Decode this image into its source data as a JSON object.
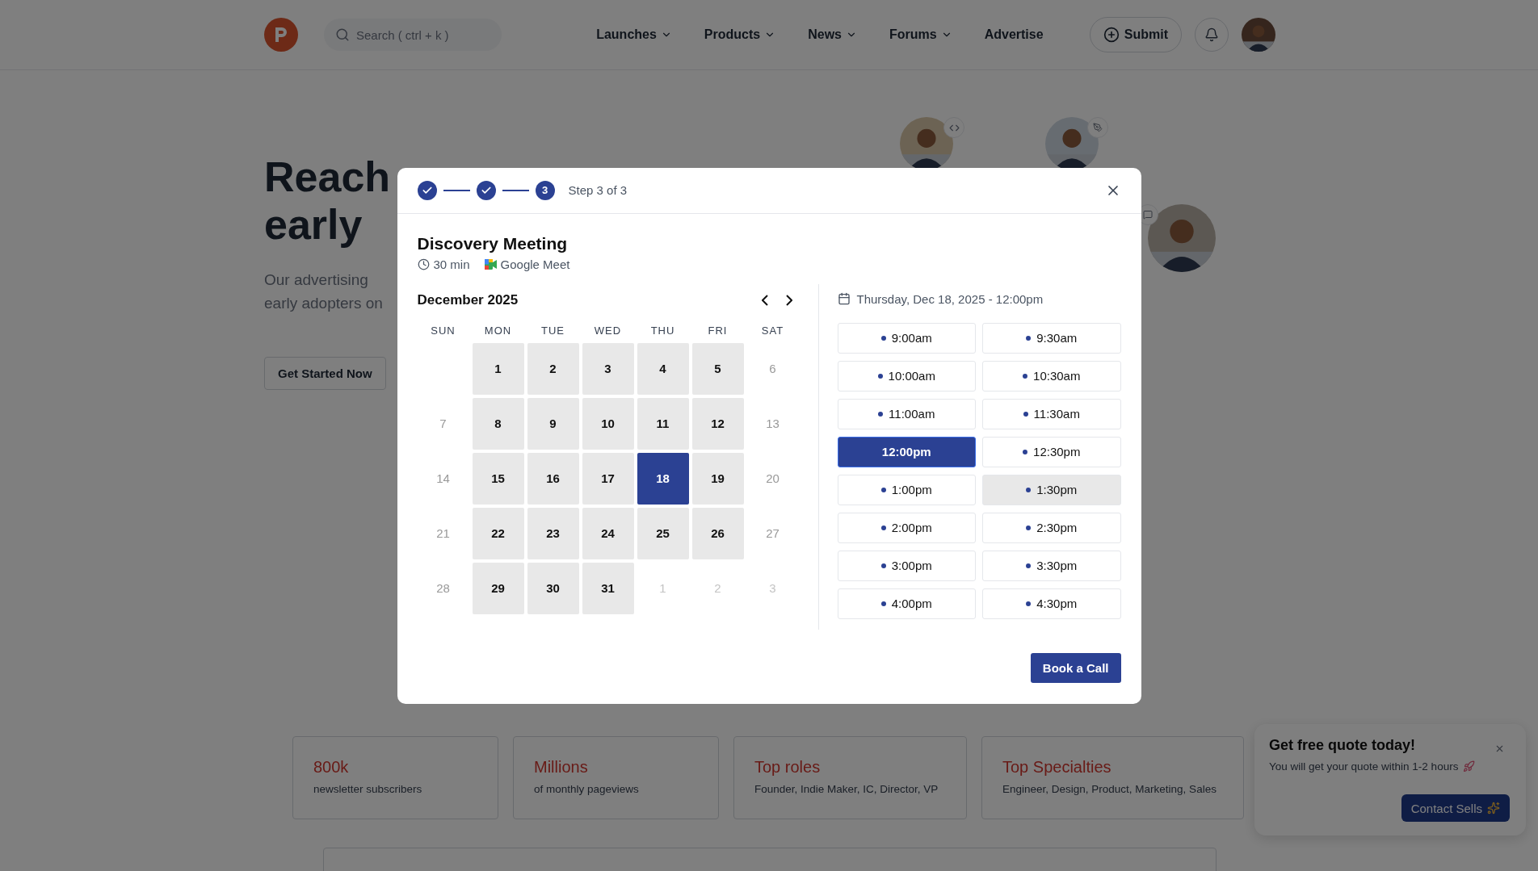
{
  "header": {
    "search": {
      "placeholder": "Search ( ctrl + k )"
    },
    "nav": [
      {
        "label": "Launches",
        "dropdown": true
      },
      {
        "label": "Products",
        "dropdown": true
      },
      {
        "label": "News",
        "dropdown": true
      },
      {
        "label": "Forums",
        "dropdown": true
      },
      {
        "label": "Advertise",
        "dropdown": false
      }
    ],
    "submit": "Submit"
  },
  "hero": {
    "title_lines": [
      "Reach",
      "early"
    ],
    "subtitle_lines": [
      "Our advertising",
      "early adopters on"
    ],
    "cta": "Get Started Now"
  },
  "stats": [
    {
      "value": "800k",
      "label": "newsletter subscribers"
    },
    {
      "value": "Millions",
      "label": "of monthly pageviews"
    },
    {
      "value": "Top roles",
      "label": "Founder, Indie Maker, IC, Director, VP"
    },
    {
      "value": "Top Specialties",
      "label": "Engineer, Design, Product, Marketing, Sales"
    }
  ],
  "quote_popup": {
    "title": "Get free quote today!",
    "text": "You will get your quote within 1-2 hours",
    "button": "Contact Sells"
  },
  "modal": {
    "steps": [
      {
        "done": true
      },
      {
        "done": true
      },
      {
        "done": false,
        "label": "3"
      }
    ],
    "step_text": "Step 3 of 3",
    "title": "Discovery Meeting",
    "duration": "30 min",
    "platform": "Google Meet",
    "calendar": {
      "month": "December 2025",
      "weekdays": [
        "SUN",
        "MON",
        "TUE",
        "WED",
        "THU",
        "FRI",
        "SAT"
      ],
      "weeks": [
        {
          "days": [
            {
              "label": "1",
              "kind": "available",
              "selected": false
            },
            {
              "label": "2",
              "kind": "available",
              "selected": false
            },
            {
              "label": "3",
              "kind": "available",
              "selected": false
            },
            {
              "label": "4",
              "kind": "available",
              "selected": false
            },
            {
              "label": "5",
              "kind": "available",
              "selected": false
            },
            {
              "label": "6",
              "kind": "unavailable",
              "selected": false
            }
          ]
        },
        {
          "days": [
            {
              "label": "7",
              "kind": "unavailable",
              "selected": false
            },
            {
              "label": "8",
              "kind": "available",
              "selected": false
            },
            {
              "label": "9",
              "kind": "available",
              "selected": false
            },
            {
              "label": "10",
              "kind": "available",
              "selected": false
            },
            {
              "label": "11",
              "kind": "available",
              "selected": false
            },
            {
              "label": "12",
              "kind": "available",
              "selected": false
            },
            {
              "label": "13",
              "kind": "unavailable",
              "selected": false
            }
          ]
        },
        {
          "days": [
            {
              "label": "14",
              "kind": "unavailable",
              "selected": false
            },
            {
              "label": "15",
              "kind": "available",
              "selected": false
            },
            {
              "label": "16",
              "kind": "available",
              "selected": false
            },
            {
              "label": "17",
              "kind": "available",
              "selected": false
            },
            {
              "label": "18",
              "kind": "available",
              "selected": true
            },
            {
              "label": "19",
              "kind": "available",
              "selected": false
            },
            {
              "label": "20",
              "kind": "unavailable",
              "selected": false
            }
          ]
        },
        {
          "days": [
            {
              "label": "21",
              "kind": "unavailable",
              "selected": false
            },
            {
              "label": "22",
              "kind": "available",
              "selected": false
            },
            {
              "label": "23",
              "kind": "available",
              "selected": false
            },
            {
              "label": "24",
              "kind": "available",
              "selected": false
            },
            {
              "label": "25",
              "kind": "available",
              "selected": false
            },
            {
              "label": "26",
              "kind": "available",
              "selected": false
            },
            {
              "label": "27",
              "kind": "unavailable",
              "selected": false
            }
          ]
        },
        {
          "days": [
            {
              "label": "28",
              "kind": "unavailable",
              "selected": false
            },
            {
              "label": "29",
              "kind": "available",
              "selected": false
            },
            {
              "label": "30",
              "kind": "available",
              "selected": false
            },
            {
              "label": "31",
              "kind": "available",
              "selected": false
            },
            {
              "label": "1",
              "kind": "outside",
              "selected": false
            },
            {
              "label": "2",
              "kind": "outside",
              "selected": false
            },
            {
              "label": "3",
              "kind": "outside",
              "selected": false
            }
          ]
        }
      ]
    },
    "selected_datetime": "Thursday, Dec 18, 2025 - 12:00pm",
    "slots": [
      {
        "time": "9:00am",
        "selected": false,
        "hovered": false
      },
      {
        "time": "9:30am",
        "selected": false,
        "hovered": false
      },
      {
        "time": "10:00am",
        "selected": false,
        "hovered": false
      },
      {
        "time": "10:30am",
        "selected": false,
        "hovered": false
      },
      {
        "time": "11:00am",
        "selected": false,
        "hovered": false
      },
      {
        "time": "11:30am",
        "selected": false,
        "hovered": false
      },
      {
        "time": "12:00pm",
        "selected": true,
        "hovered": false
      },
      {
        "time": "12:30pm",
        "selected": false,
        "hovered": false
      },
      {
        "time": "1:00pm",
        "selected": false,
        "hovered": false
      },
      {
        "time": "1:30pm",
        "selected": false,
        "hovered": true
      },
      {
        "time": "2:00pm",
        "selected": false,
        "hovered": false
      },
      {
        "time": "2:30pm",
        "selected": false,
        "hovered": false
      },
      {
        "time": "3:00pm",
        "selected": false,
        "hovered": false
      },
      {
        "time": "3:30pm",
        "selected": false,
        "hovered": false
      },
      {
        "time": "4:00pm",
        "selected": false,
        "hovered": false
      },
      {
        "time": "4:30pm",
        "selected": false,
        "hovered": false
      }
    ],
    "book_button": "Book a Call"
  }
}
